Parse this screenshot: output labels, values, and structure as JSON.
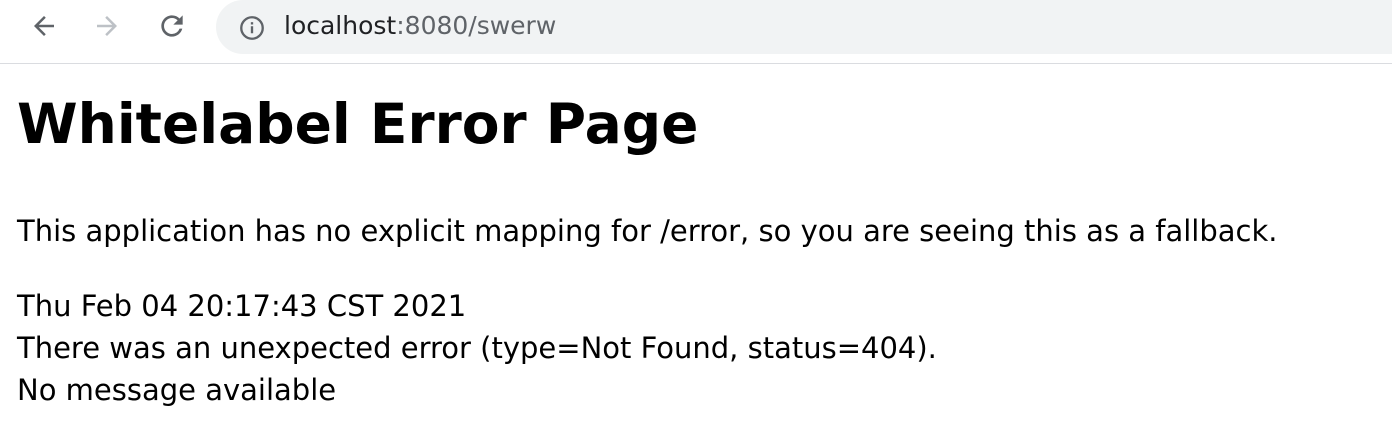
{
  "browser": {
    "url_host": "localhost",
    "url_rest": ":8080/swerw",
    "icons": {
      "back": "arrow-left-icon",
      "forward": "arrow-right-icon",
      "reload": "reload-icon",
      "site_info": "info-icon"
    },
    "colors": {
      "toolbar_bg": "#ffffff",
      "omnibox_bg": "#f1f3f4",
      "icon_active": "#5f6368",
      "icon_disabled": "#bdc1c6"
    }
  },
  "page": {
    "title": "Whitelabel Error Page",
    "message": "This application has no explicit mapping for /error, so you are seeing this as a fallback.",
    "timestamp": "Thu Feb 04 20:17:43 CST 2021",
    "error_line": "There was an unexpected error (type=Not Found, status=404).",
    "detail": "No message available"
  }
}
